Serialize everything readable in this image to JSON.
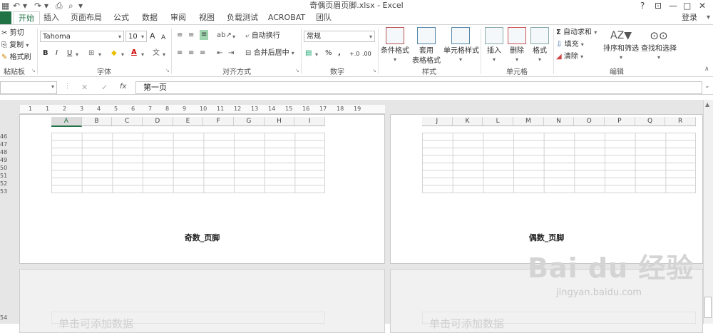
{
  "window": {
    "title": "奇偶页眉页脚.xlsx - Excel",
    "help": "?",
    "restore": "⊡",
    "minimize": "—",
    "maximize": "□",
    "close": "✕"
  },
  "quick_access": {
    "undo": "↶",
    "redo": "↷",
    "preview": "⌕"
  },
  "tabs": [
    {
      "label": "开始",
      "active": true
    },
    {
      "label": "插入"
    },
    {
      "label": "页面布局"
    },
    {
      "label": "公式"
    },
    {
      "label": "数据"
    },
    {
      "label": "审阅"
    },
    {
      "label": "视图"
    },
    {
      "label": "负载测试"
    },
    {
      "label": "ACROBAT"
    },
    {
      "label": "团队"
    }
  ],
  "login": "登录",
  "ribbon": {
    "clipboard": {
      "label": "粘贴板",
      "cut": "剪切",
      "copy": "复制",
      "format_painter": "格式刷"
    },
    "font": {
      "label": "字体",
      "font_name": "Tahoma",
      "font_size": "10",
      "grow": "A",
      "shrink": "A",
      "bold": "B",
      "italic": "I",
      "underline": "U",
      "font_color": "A",
      "fill_color": "◆"
    },
    "alignment": {
      "label": "对齐方式",
      "wrap_text": "自动换行",
      "merge_center": "合并后居中"
    },
    "number": {
      "label": "数字",
      "format": "常规",
      "percent": "%",
      "comma": ",",
      "inc_decimal": "+.0",
      "dec_decimal": ".00"
    },
    "styles": {
      "label": "样式",
      "conditional": "条件格式",
      "table_format_1": "套用",
      "table_format_2": "表格格式",
      "cell_styles": "单元格样式"
    },
    "cells": {
      "label": "单元格",
      "insert": "插入",
      "delete": "删除",
      "format": "格式"
    },
    "editing": {
      "label": "编辑",
      "autosum": "自动求和",
      "fill": "填充",
      "clear": "清除",
      "sort_filter": "排序和筛选",
      "find_select": "查找和选择"
    }
  },
  "formula_bar": {
    "name_box": "",
    "cancel": "✕",
    "enter": "✓",
    "fx": "fx",
    "value": "第一页"
  },
  "ruler": [
    "1",
    "1",
    "2",
    "3",
    "4",
    "5",
    "6",
    "7",
    "8",
    "9",
    "10",
    "11",
    "12",
    "13",
    "14",
    "15",
    "16",
    "17",
    "18",
    "19"
  ],
  "columns_left": [
    "A",
    "B",
    "C",
    "D",
    "E",
    "F",
    "G",
    "H",
    "I"
  ],
  "columns_right": [
    "J",
    "K",
    "L",
    "M",
    "N",
    "O",
    "P",
    "Q",
    "R"
  ],
  "row_numbers": [
    "46",
    "47",
    "48",
    "49",
    "50",
    "51",
    "52",
    "53"
  ],
  "row_number_bottom": "54",
  "footer_odd": "奇数_页脚",
  "footer_even": "偶数_页脚",
  "add_data_left": "单击可添加数据",
  "add_data_right": "单击可添加数据",
  "watermark": {
    "brand": "Bai du 经验",
    "url": "jingyan.baidu.com"
  }
}
